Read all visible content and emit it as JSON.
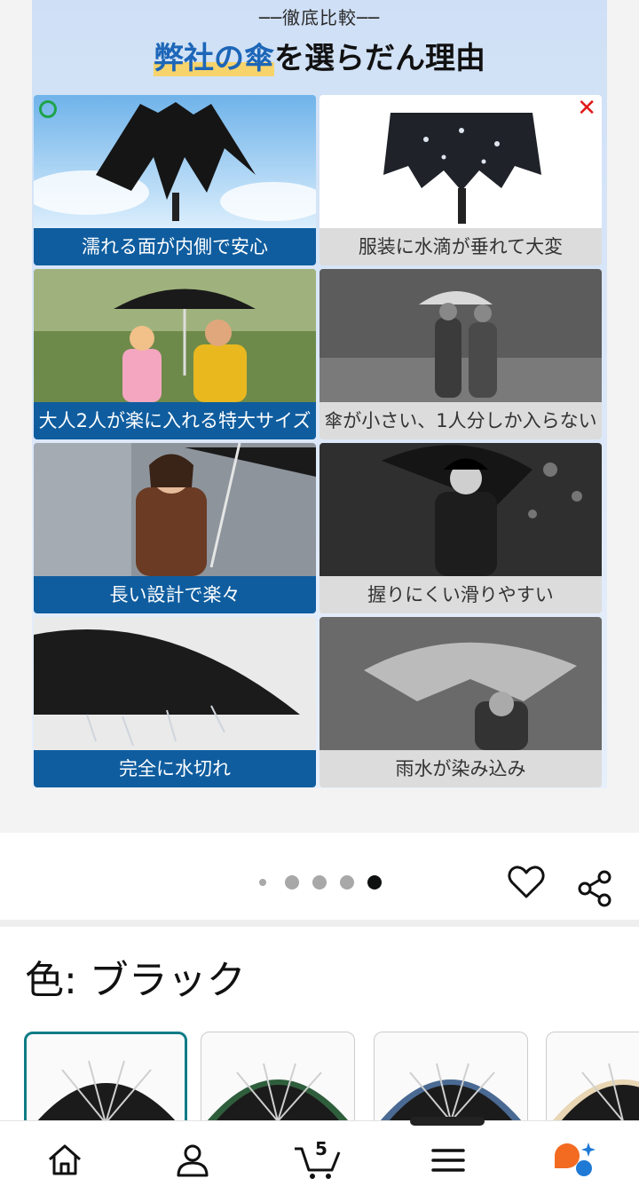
{
  "banner": {
    "subtitle": "──徹底比較──",
    "title_highlight": "弊社の傘",
    "title_rest": "を選らだん理由",
    "good_mark": "○",
    "bad_mark": "✕"
  },
  "comparison": [
    {
      "good": "濡れる面が内側で安心",
      "bad": "服装に水滴が垂れて大変"
    },
    {
      "good": "大人2人が楽に入れる特大サイズ",
      "bad": "傘が小さい、1人分しか入らない"
    },
    {
      "good": "長い設計で楽々",
      "bad": "握りにくい滑りやすい"
    },
    {
      "good": "完全に水切れ",
      "bad": "雨水が染み込み"
    }
  ],
  "carousel": {
    "total": 5,
    "active_index": 4
  },
  "actions": {
    "favorite_icon": "heart-icon",
    "share_icon": "share-icon"
  },
  "color_selector": {
    "label": "色: ブラック",
    "options": [
      {
        "name": "black",
        "trim": "#1b1b1b",
        "selected": true
      },
      {
        "name": "green",
        "trim": "#2f5e3c",
        "selected": false
      },
      {
        "name": "blue",
        "trim": "#4a6a93",
        "selected": false
      },
      {
        "name": "beige",
        "trim": "#e8d6b4",
        "selected": false
      }
    ]
  },
  "bottom_nav": {
    "items": [
      "home-icon",
      "account-icon",
      "cart-icon",
      "menu-icon",
      "assistant-icon"
    ],
    "cart_count": "5"
  },
  "colors": {
    "good_bg": "#0f5d9f",
    "bad_bg": "#dcdcdc",
    "accent_teal": "#0e7c86",
    "assistant_orange": "#f26b21",
    "assistant_blue": "#1f7ad6"
  }
}
